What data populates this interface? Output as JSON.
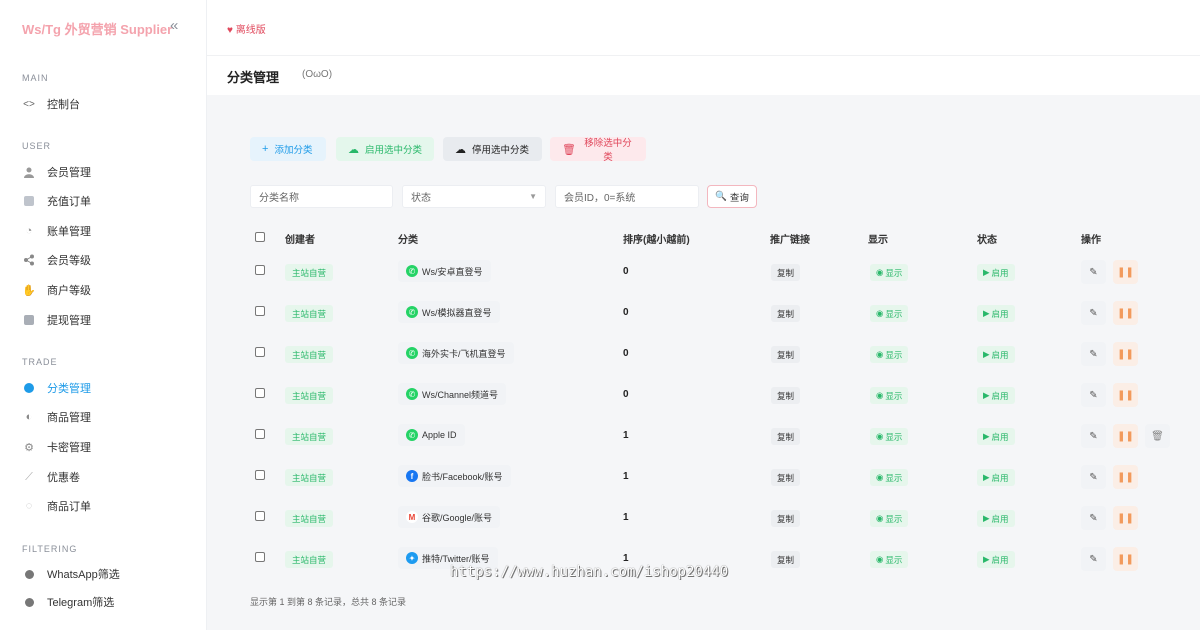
{
  "brand": "Ws/Tg 外贸营销 Supplier",
  "sidebar": {
    "sections": [
      {
        "title": "MAIN",
        "items": [
          {
            "label": "控制台",
            "icon": "code-icon"
          }
        ]
      },
      {
        "title": "USER",
        "items": [
          {
            "label": "会员管理",
            "icon": "user-icon"
          },
          {
            "label": "充值订单",
            "icon": "receipt-icon"
          },
          {
            "label": "账单管理",
            "icon": "bill-icon"
          },
          {
            "label": "会员等级",
            "icon": "share-icon"
          },
          {
            "label": "商户等级",
            "icon": "hand-icon"
          },
          {
            "label": "提现管理",
            "icon": "wallet-icon"
          }
        ]
      },
      {
        "title": "TRADE",
        "items": [
          {
            "label": "分类管理",
            "icon": "category-icon"
          },
          {
            "label": "商品管理",
            "icon": "goods-icon"
          },
          {
            "label": "卡密管理",
            "icon": "key-icon"
          },
          {
            "label": "优惠卷",
            "icon": "coupon-icon"
          },
          {
            "label": "商品订单",
            "icon": "order-icon"
          }
        ]
      },
      {
        "title": "FILTERING",
        "items": [
          {
            "label": "WhatsApp筛选",
            "icon": "filter-icon"
          },
          {
            "label": "Telegram筛选",
            "icon": "filter-icon"
          }
        ]
      }
    ]
  },
  "header": {
    "offline": "离线版"
  },
  "page": {
    "title": "分类管理",
    "subtitle": "(OωO)"
  },
  "toolbar": {
    "add": "添加分类",
    "enable": "启用选中分类",
    "disable": "停用选中分类",
    "remove": "移除选中分类"
  },
  "filters": {
    "name_placeholder": "分类名称",
    "status_label": "状态",
    "member_placeholder": "会员ID，0=系统",
    "search": "查询"
  },
  "table": {
    "headers": [
      "创建者",
      "分类",
      "排序(越小越前)",
      "推广链接",
      "显示",
      "状态",
      "操作"
    ],
    "rows": [
      {
        "creator": "主站自营",
        "category": "Ws/安卓直登号",
        "icon": "wa",
        "sort": "0",
        "link": "复制",
        "show": "显示",
        "status": "启用",
        "delete": false
      },
      {
        "creator": "主站自营",
        "category": "Ws/模拟器直登号",
        "icon": "wa",
        "sort": "0",
        "link": "复制",
        "show": "显示",
        "status": "启用",
        "delete": false
      },
      {
        "creator": "主站自营",
        "category": "海外实卡/飞机直登号",
        "icon": "wa",
        "sort": "0",
        "link": "复制",
        "show": "显示",
        "status": "启用",
        "delete": false
      },
      {
        "creator": "主站自营",
        "category": "Ws/Channel频道号",
        "icon": "wa",
        "sort": "0",
        "link": "复制",
        "show": "显示",
        "status": "启用",
        "delete": false
      },
      {
        "creator": "主站自营",
        "category": "Apple ID",
        "icon": "wa",
        "sort": "1",
        "link": "复制",
        "show": "显示",
        "status": "启用",
        "delete": true
      },
      {
        "creator": "主站自营",
        "category": "脸书/Facebook/账号",
        "icon": "fb",
        "sort": "1",
        "link": "复制",
        "show": "显示",
        "status": "启用",
        "delete": false
      },
      {
        "creator": "主站自营",
        "category": "谷歌/Google/账号",
        "icon": "gg",
        "sort": "1",
        "link": "复制",
        "show": "显示",
        "status": "启用",
        "delete": false
      },
      {
        "creator": "主站自营",
        "category": "推特/Twitter/账号",
        "icon": "tw",
        "sort": "1",
        "link": "复制",
        "show": "显示",
        "status": "启用",
        "delete": false
      }
    ]
  },
  "pagination": "显示第 1 到第 8 条记录，总共 8 条记录",
  "watermark": "https://www.huzhan.com/ishop20440"
}
